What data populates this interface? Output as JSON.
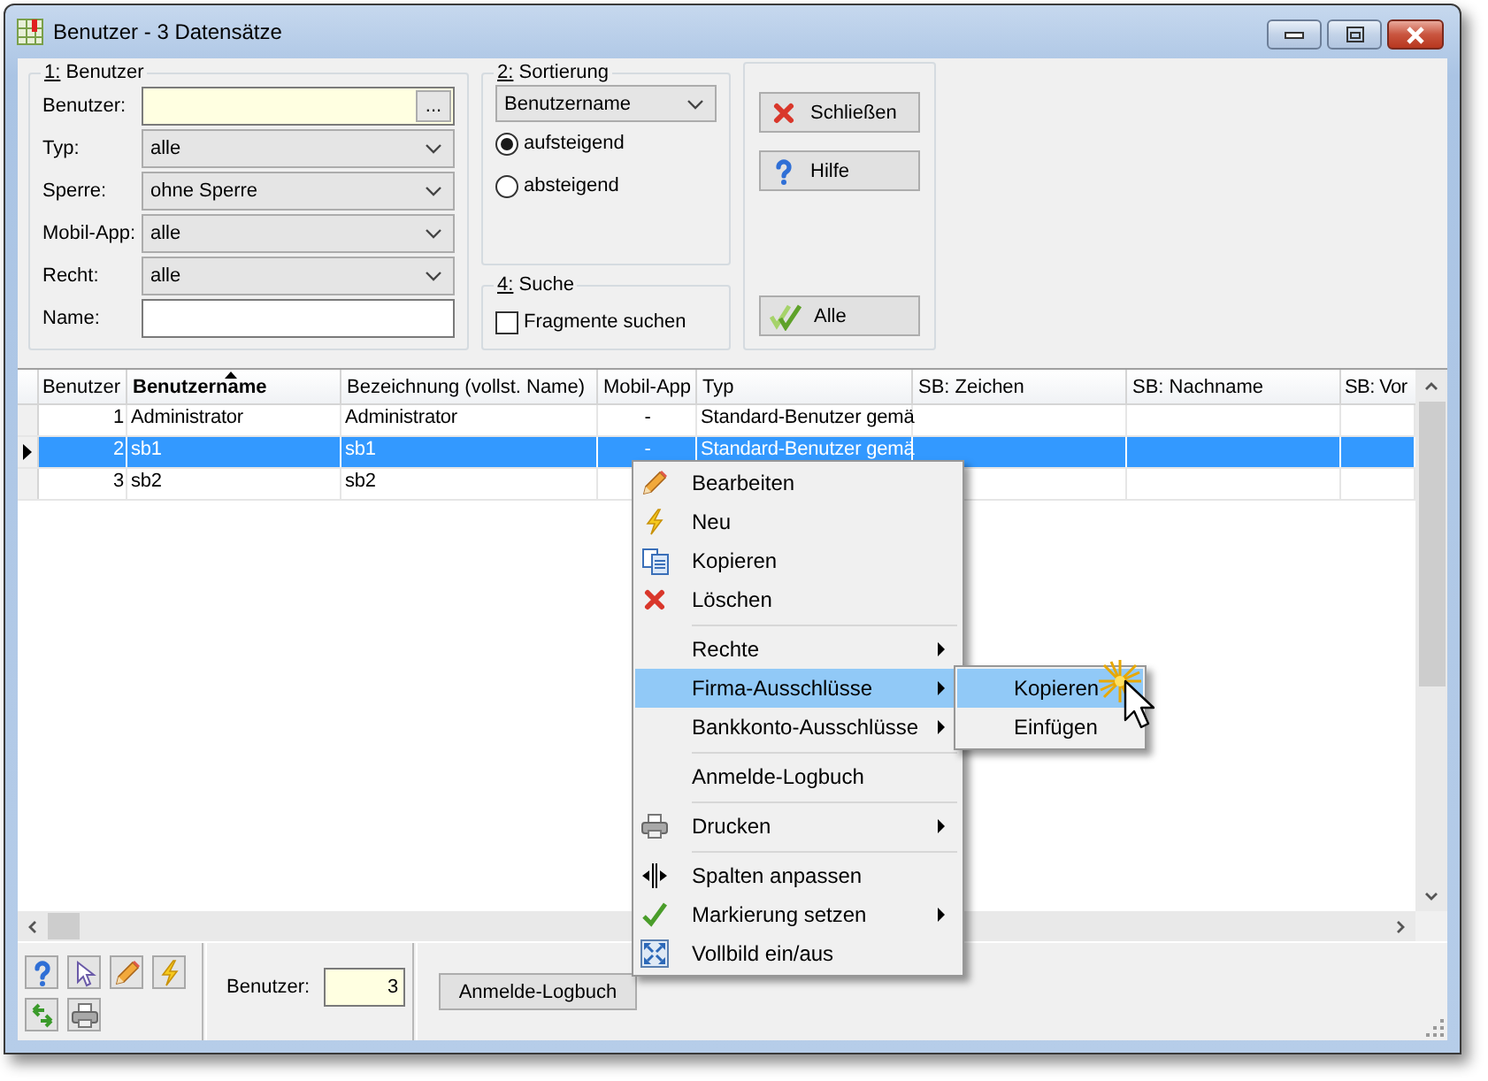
{
  "window": {
    "title": "Benutzer - 3 Datensätze"
  },
  "filters": {
    "title": "1: Benutzer",
    "fields": [
      {
        "label": "Benutzer:",
        "kind": "lookup",
        "button": "..."
      },
      {
        "label": "Typ:",
        "kind": "select",
        "value": "alle"
      },
      {
        "label": "Sperre:",
        "kind": "select",
        "value": "ohne Sperre"
      },
      {
        "label": "Mobil-App:",
        "kind": "select",
        "value": "alle"
      },
      {
        "label": "Recht:",
        "kind": "select",
        "value": "alle"
      },
      {
        "label": "Name:",
        "kind": "text"
      }
    ]
  },
  "sort": {
    "title": "2: Sortierung",
    "field": "Benutzername",
    "options": [
      {
        "label": "aufsteigend",
        "selected": true
      },
      {
        "label": "absteigend",
        "selected": false
      }
    ]
  },
  "search": {
    "title": "4: Suche",
    "options": [
      {
        "label": "Fragmente suchen",
        "checked": false
      }
    ]
  },
  "buttons": [
    {
      "label": "Schließen",
      "kind": "close"
    },
    {
      "label": "Hilfe",
      "kind": "help"
    },
    {
      "label": "Alle",
      "kind": "all"
    }
  ],
  "table": {
    "columns": [
      {
        "label": "Benutzer",
        "kind": "number",
        "sorted": false
      },
      {
        "label": "Benutzername",
        "kind": "text",
        "sorted": true
      },
      {
        "label": "Bezeichnung (vollst. Name)",
        "kind": "text",
        "sorted": false
      },
      {
        "label": "Mobil-App",
        "kind": "center",
        "sorted": false
      },
      {
        "label": "Typ",
        "kind": "text",
        "sorted": false
      },
      {
        "label": "SB: Zeichen",
        "kind": "text",
        "sorted": false
      },
      {
        "label": "SB: Nachname",
        "kind": "text",
        "sorted": false
      },
      {
        "label": "SB: Vor",
        "kind": "text",
        "sorted": false
      }
    ],
    "rows": [
      {
        "selected": false,
        "current": false,
        "cells": [
          "1",
          "Administrator",
          "Administrator",
          "-",
          "Standard-Benutzer gemä"
        ]
      },
      {
        "selected": true,
        "current": true,
        "cells": [
          "2",
          "sb1",
          "sb1",
          "-",
          "Standard-Benutzer gemä"
        ]
      },
      {
        "selected": false,
        "current": false,
        "cells": [
          "3",
          "sb2",
          "sb2"
        ]
      }
    ]
  },
  "toolbar": [
    {
      "kind": "help"
    },
    {
      "kind": "pointer"
    },
    {
      "kind": "edit"
    },
    {
      "kind": "new"
    },
    {
      "kind": "refresh"
    },
    {
      "kind": "print"
    }
  ],
  "status": {
    "label": "Benutzer:",
    "value": "3",
    "button": "Anmelde-Logbuch"
  },
  "context_menu": {
    "items": [
      {
        "kind": "edit",
        "label": "Bearbeiten",
        "submenu": false,
        "selected": false
      },
      {
        "kind": "new",
        "label": "Neu",
        "submenu": false,
        "selected": false
      },
      {
        "kind": "copy",
        "label": "Kopieren",
        "submenu": false,
        "selected": false
      },
      {
        "kind": "delete",
        "label": "Löschen",
        "submenu": false,
        "selected": false
      },
      {
        "kind": "separator"
      },
      {
        "kind": "plain",
        "label": "Rechte",
        "submenu": true,
        "selected": false
      },
      {
        "kind": "plain",
        "label": "Firma-Ausschlüsse",
        "submenu": true,
        "selected": true
      },
      {
        "kind": "plain",
        "label": "Bankkonto-Ausschlüsse",
        "submenu": true,
        "selected": false
      },
      {
        "kind": "separator"
      },
      {
        "kind": "plain",
        "label": "Anmelde-Logbuch",
        "submenu": false,
        "selected": false
      },
      {
        "kind": "separator"
      },
      {
        "kind": "print",
        "label": "Drucken",
        "submenu": true,
        "selected": false
      },
      {
        "kind": "separator"
      },
      {
        "kind": "columns",
        "label": "Spalten anpassen",
        "submenu": false,
        "selected": false
      },
      {
        "kind": "check",
        "label": "Markierung setzen",
        "submenu": true,
        "selected": false
      },
      {
        "kind": "fullscreen",
        "label": "Vollbild ein/aus",
        "submenu": false,
        "selected": false
      }
    ]
  },
  "submenu": {
    "items": [
      {
        "label": "Kopieren",
        "selected": true
      },
      {
        "label": "Einfügen",
        "selected": false
      }
    ]
  }
}
